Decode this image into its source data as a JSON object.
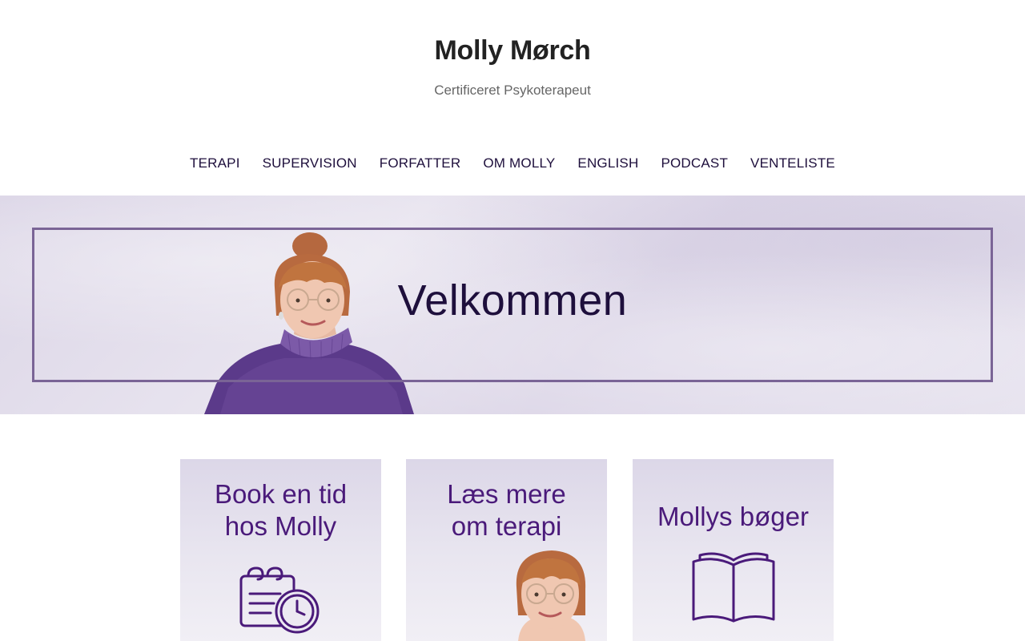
{
  "header": {
    "site_title": "Molly Mørch",
    "tagline": "Certificeret Psykoterapeut"
  },
  "nav": {
    "items": [
      {
        "label": "TERAPI"
      },
      {
        "label": "SUPERVISION"
      },
      {
        "label": "FORFATTER"
      },
      {
        "label": "OM MOLLY"
      },
      {
        "label": "ENGLISH"
      },
      {
        "label": "PODCAST"
      },
      {
        "label": "VENTELISTE"
      }
    ]
  },
  "hero": {
    "title": "Velkommen"
  },
  "cards": [
    {
      "line1": "Book en tid",
      "line2": "hos Molly",
      "icon": "calendar-clock-icon"
    },
    {
      "line1": "Læs mere",
      "line2": "om terapi",
      "icon": "portrait"
    },
    {
      "line1": "Mollys bøger",
      "icon": "open-book-icon"
    }
  ],
  "colors": {
    "text_dark": "#222222",
    "nav_text": "#1e0f3c",
    "accent_purple": "#4a1a7a",
    "frame_purple": "#7a6496"
  }
}
